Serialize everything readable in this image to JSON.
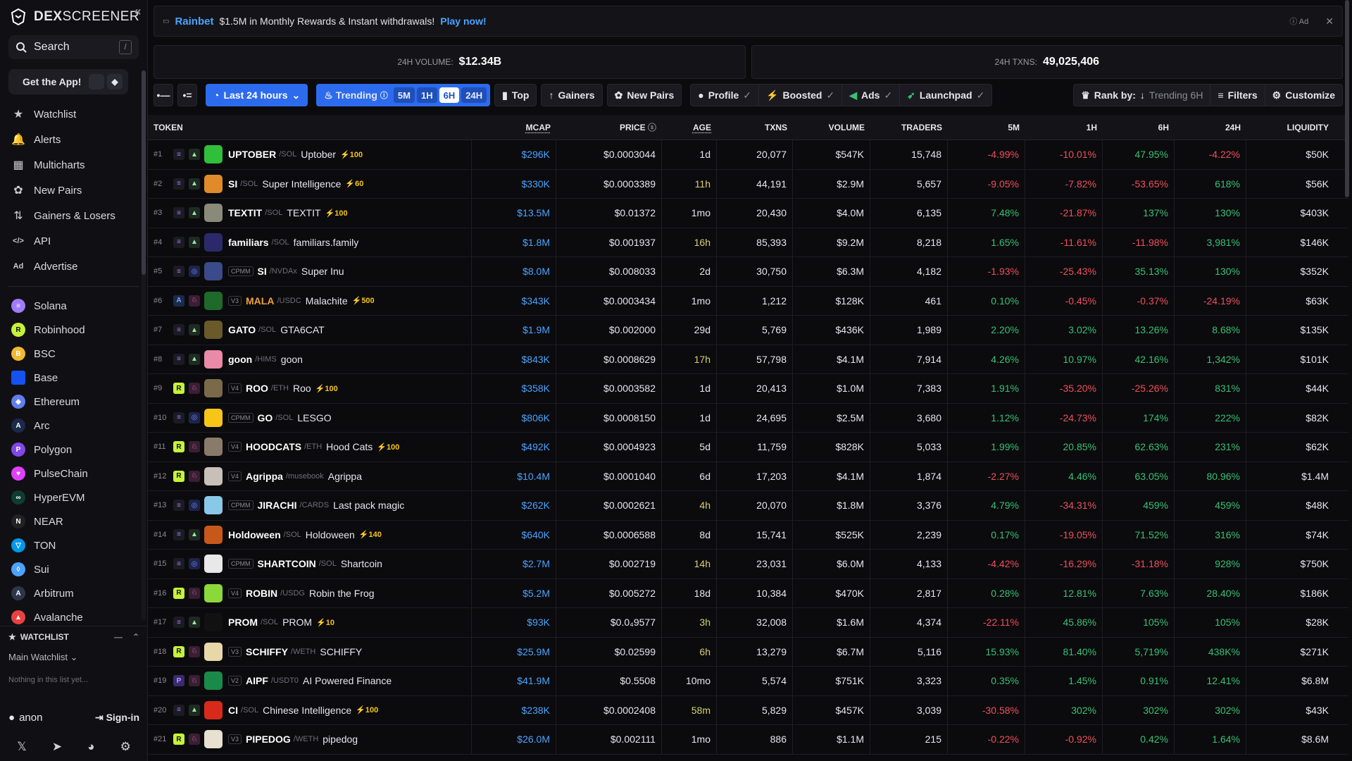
{
  "brand": {
    "name_bold": "DEX",
    "name_light": "SCREENER"
  },
  "search": {
    "label": "Search",
    "shortcut": "/"
  },
  "get_app": {
    "label": "Get the App!"
  },
  "nav": [
    {
      "label": "Watchlist",
      "icon": "star-icon"
    },
    {
      "label": "Alerts",
      "icon": "bell-icon"
    },
    {
      "label": "Multicharts",
      "icon": "grid-icon"
    },
    {
      "label": "New Pairs",
      "icon": "sprout-icon"
    },
    {
      "label": "Gainers & Losers",
      "icon": "arrows-icon"
    },
    {
      "label": "API",
      "icon": "code-icon"
    },
    {
      "label": "Advertise",
      "icon": "ad-icon"
    }
  ],
  "chains": [
    {
      "label": "Solana",
      "color": "#9f7bff",
      "glyph": "≡"
    },
    {
      "label": "Robinhood",
      "color": "#c5f23a",
      "glyph": "R"
    },
    {
      "label": "BSC",
      "color": "#f3ba2f",
      "glyph": "B"
    },
    {
      "label": "Base",
      "color": "#1652f0",
      "glyph": ""
    },
    {
      "label": "Ethereum",
      "color": "#627eea",
      "glyph": "◆"
    },
    {
      "label": "Arc",
      "color": "#1b2a4a",
      "glyph": "A"
    },
    {
      "label": "Polygon",
      "color": "#8247e5",
      "glyph": "P"
    },
    {
      "label": "PulseChain",
      "color": "#e040fb",
      "glyph": "♥"
    },
    {
      "label": "HyperEVM",
      "color": "#0f3b33",
      "glyph": "∞"
    },
    {
      "label": "NEAR",
      "color": "#222",
      "glyph": "N"
    },
    {
      "label": "TON",
      "color": "#0098ea",
      "glyph": "▽"
    },
    {
      "label": "Sui",
      "color": "#4da2ff",
      "glyph": "◊"
    },
    {
      "label": "Arbitrum",
      "color": "#2d374b",
      "glyph": "A"
    },
    {
      "label": "Avalanche",
      "color": "#e84142",
      "glyph": "▲"
    }
  ],
  "watchlist": {
    "title": "WATCHLIST",
    "main": "Main Watchlist",
    "empty": "Nothing in this list yet..."
  },
  "account": {
    "user": "anon",
    "sign_in": "Sign-in"
  },
  "ad": {
    "brand": "Rainbet",
    "text": "$1.5M in Monthly Rewards & Instant withdrawals!",
    "cta": "Play now!",
    "label": "Ad"
  },
  "stats": {
    "volume_label": "24H VOLUME:",
    "volume": "$12.34B",
    "txns_label": "24H TXNS:",
    "txns": "49,025,406"
  },
  "toolbar": {
    "range": "Last 24 hours",
    "trending": "Trending",
    "timeframes": [
      "5M",
      "1H",
      "6H",
      "24H"
    ],
    "active_timeframe": "6H",
    "top": "Top",
    "gainers": "Gainers",
    "new_pairs": "New Pairs",
    "profile": "Profile",
    "boosted": "Boosted",
    "ads": "Ads",
    "launchpad": "Launchpad",
    "rank_by": "Rank by:",
    "rank_value": "Trending 6H",
    "filters": "Filters",
    "customize": "Customize"
  },
  "columns": {
    "token": "TOKEN",
    "mcap": "MCAP",
    "price": "PRICE",
    "age": "AGE",
    "txns": "TXNS",
    "volume": "VOLUME",
    "traders": "TRADERS",
    "m5": "5M",
    "h1": "1H",
    "h6": "6H",
    "h24": "24H",
    "liquidity": "LIQUIDITY"
  },
  "rows": [
    {
      "rank": "#1",
      "chain": "sol",
      "dex": "pump",
      "ver": "",
      "sym": "UPTOBER",
      "quote": "SOL",
      "name": "Uptober",
      "boost": "100",
      "av": "#2fbf3a",
      "mcap": "$296K",
      "price": "$0.0003044",
      "age": "1d",
      "txns": "20,077",
      "volume": "$547K",
      "traders": "15,748",
      "m5": "-4.99%",
      "h1": "-10.01%",
      "h6": "47.95%",
      "h24": "-4.22%",
      "liq": "$50K"
    },
    {
      "rank": "#2",
      "chain": "sol",
      "dex": "pump",
      "ver": "",
      "sym": "SI",
      "quote": "SOL",
      "name": "Super Intelligence",
      "boost": "60",
      "av": "#e08a2a",
      "mcap": "$330K",
      "price": "$0.0003389",
      "age": "11h",
      "txns": "44,191",
      "volume": "$2.9M",
      "traders": "5,657",
      "m5": "-9.05%",
      "h1": "-7.82%",
      "h6": "-53.65%",
      "h24": "618%",
      "liq": "$56K"
    },
    {
      "rank": "#3",
      "chain": "sol",
      "dex": "pump",
      "ver": "",
      "sym": "TEXTIT",
      "quote": "SOL",
      "name": "TEXTIT",
      "boost": "100",
      "av": "#8a8a7a",
      "mcap": "$13.5M",
      "price": "$0.01372",
      "age": "1mo",
      "txns": "20,430",
      "volume": "$4.0M",
      "traders": "6,135",
      "m5": "7.48%",
      "h1": "-21.87%",
      "h6": "137%",
      "h24": "130%",
      "liq": "$403K"
    },
    {
      "rank": "#4",
      "chain": "sol",
      "dex": "pump",
      "ver": "",
      "sym": "familiars",
      "quote": "SOL",
      "name": "familiars.family",
      "boost": "",
      "av": "#2a2a6a",
      "mcap": "$1.8M",
      "price": "$0.001937",
      "age": "16h",
      "txns": "85,393",
      "volume": "$9.2M",
      "traders": "8,218",
      "m5": "1.65%",
      "h1": "-11.61%",
      "h6": "-11.98%",
      "h24": "3,981%",
      "liq": "$146K"
    },
    {
      "rank": "#5",
      "chain": "sol",
      "dex": "c",
      "ver": "CPMM",
      "sym": "SI",
      "quote": "NVDAx",
      "name": "Super Inu",
      "boost": "",
      "av": "#3a4a8a",
      "mcap": "$8.0M",
      "price": "$0.008033",
      "age": "2d",
      "txns": "30,750",
      "volume": "$6.3M",
      "traders": "4,182",
      "m5": "-1.93%",
      "h1": "-25.43%",
      "h6": "35.13%",
      "h24": "130%",
      "liq": "$352K"
    },
    {
      "rank": "#6",
      "chain": "arc",
      "dex": "uni",
      "ver": "V3",
      "sym": "MALA",
      "quote": "USDC",
      "name": "Malachite",
      "boost": "500",
      "av": "#1e6a2a",
      "mcap": "$343K",
      "price": "$0.0003434",
      "age": "1mo",
      "txns": "1,212",
      "volume": "$128K",
      "traders": "461",
      "m5": "0.10%",
      "h1": "-0.45%",
      "h6": "-0.37%",
      "h24": "-24.19%",
      "liq": "$63K",
      "orange": true
    },
    {
      "rank": "#7",
      "chain": "sol",
      "dex": "pump",
      "ver": "",
      "sym": "GATO",
      "quote": "SOL",
      "name": "GTA6CAT",
      "boost": "",
      "av": "#6a5a2a",
      "mcap": "$1.9M",
      "price": "$0.002000",
      "age": "29d",
      "txns": "5,769",
      "volume": "$436K",
      "traders": "1,989",
      "m5": "2.20%",
      "h1": "3.02%",
      "h6": "13.26%",
      "h24": "8.68%",
      "liq": "$135K"
    },
    {
      "rank": "#8",
      "chain": "sol",
      "dex": "pump",
      "ver": "",
      "sym": "goon",
      "quote": "HIMS",
      "name": "goon",
      "boost": "",
      "av": "#e88aa8",
      "mcap": "$843K",
      "price": "$0.0008629",
      "age": "17h",
      "txns": "57,798",
      "volume": "$4.1M",
      "traders": "7,914",
      "m5": "4.26%",
      "h1": "10.97%",
      "h6": "42.16%",
      "h24": "1,342%",
      "liq": "$101K"
    },
    {
      "rank": "#9",
      "chain": "rob",
      "dex": "uni",
      "ver": "V4",
      "sym": "ROO",
      "quote": "ETH",
      "name": "Roo",
      "boost": "100",
      "av": "#7a6a4a",
      "mcap": "$358K",
      "price": "$0.0003582",
      "age": "1d",
      "txns": "20,413",
      "volume": "$1.0M",
      "traders": "7,383",
      "m5": "1.91%",
      "h1": "-35.20%",
      "h6": "-25.26%",
      "h24": "831%",
      "liq": "$44K"
    },
    {
      "rank": "#10",
      "chain": "sol",
      "dex": "c",
      "ver": "CPMM",
      "sym": "GO",
      "quote": "SOL",
      "name": "LESGO",
      "boost": "",
      "av": "#f5c518",
      "mcap": "$806K",
      "price": "$0.0008150",
      "age": "1d",
      "txns": "24,695",
      "volume": "$2.5M",
      "traders": "3,680",
      "m5": "1.12%",
      "h1": "-24.73%",
      "h6": "174%",
      "h24": "222%",
      "liq": "$82K"
    },
    {
      "rank": "#11",
      "chain": "rob",
      "dex": "uni",
      "ver": "V4",
      "sym": "HOODCATS",
      "quote": "ETH",
      "name": "Hood Cats",
      "boost": "100",
      "av": "#8a7a6a",
      "mcap": "$492K",
      "price": "$0.0004923",
      "age": "5d",
      "txns": "11,759",
      "volume": "$828K",
      "traders": "5,033",
      "m5": "1.99%",
      "h1": "20.85%",
      "h6": "62.63%",
      "h24": "231%",
      "liq": "$62K"
    },
    {
      "rank": "#12",
      "chain": "rob",
      "dex": "uni",
      "ver": "V4",
      "sym": "Agrippa",
      "quote": "musebook",
      "name": "Agrippa",
      "boost": "",
      "av": "#c8c0b8",
      "mcap": "$10.4M",
      "price": "$0.0001040",
      "age": "6d",
      "txns": "17,203",
      "volume": "$4.1M",
      "traders": "1,874",
      "m5": "-2.27%",
      "h1": "4.46%",
      "h6": "63.05%",
      "h24": "80.96%",
      "liq": "$1.4M"
    },
    {
      "rank": "#13",
      "chain": "sol",
      "dex": "c",
      "ver": "CPMM",
      "sym": "JIRACHI",
      "quote": "CARDS",
      "name": "Last pack magic",
      "boost": "",
      "av": "#8ac8e8",
      "mcap": "$262K",
      "price": "$0.0002621",
      "age": "4h",
      "txns": "20,070",
      "volume": "$1.8M",
      "traders": "3,376",
      "m5": "4.79%",
      "h1": "-34.31%",
      "h6": "459%",
      "h24": "459%",
      "liq": "$48K"
    },
    {
      "rank": "#14",
      "chain": "sol",
      "dex": "pump",
      "ver": "",
      "sym": "Holdoween",
      "quote": "SOL",
      "name": "Holdoween",
      "boost": "140",
      "av": "#c8581a",
      "mcap": "$640K",
      "price": "$0.0006588",
      "age": "8d",
      "txns": "15,741",
      "volume": "$525K",
      "traders": "2,239",
      "m5": "0.17%",
      "h1": "-19.05%",
      "h6": "71.52%",
      "h24": "316%",
      "liq": "$74K"
    },
    {
      "rank": "#15",
      "chain": "sol",
      "dex": "c",
      "ver": "CPMM",
      "sym": "SHARTCOIN",
      "quote": "SOL",
      "name": "Shartcoin",
      "boost": "",
      "av": "#e8e8e8",
      "mcap": "$2.7M",
      "price": "$0.002719",
      "age": "14h",
      "txns": "23,031",
      "volume": "$6.0M",
      "traders": "4,133",
      "m5": "-4.42%",
      "h1": "-16.29%",
      "h6": "-31.18%",
      "h24": "928%",
      "liq": "$750K"
    },
    {
      "rank": "#16",
      "chain": "rob",
      "dex": "uni",
      "ver": "V4",
      "sym": "ROBIN",
      "quote": "USDG",
      "name": "Robin the Frog",
      "boost": "",
      "av": "#8ad83a",
      "mcap": "$5.2M",
      "price": "$0.005272",
      "age": "18d",
      "txns": "10,384",
      "volume": "$470K",
      "traders": "2,817",
      "m5": "0.28%",
      "h1": "12.81%",
      "h6": "7.63%",
      "h24": "28.40%",
      "liq": "$186K"
    },
    {
      "rank": "#17",
      "chain": "sol",
      "dex": "pump",
      "ver": "",
      "sym": "PROM",
      "quote": "SOL",
      "name": "PROM",
      "boost": "10",
      "av": "#111111",
      "mcap": "$93K",
      "price": "$0.0₄9577",
      "age": "3h",
      "txns": "32,008",
      "volume": "$1.6M",
      "traders": "4,374",
      "m5": "-22.11%",
      "h1": "45.86%",
      "h6": "105%",
      "h24": "105%",
      "liq": "$28K"
    },
    {
      "rank": "#18",
      "chain": "rob",
      "dex": "uni",
      "ver": "V3",
      "sym": "SCHIFFY",
      "quote": "WETH",
      "name": "SCHIFFY",
      "boost": "",
      "av": "#e8d8a8",
      "mcap": "$25.9M",
      "price": "$0.02599",
      "age": "6h",
      "txns": "13,279",
      "volume": "$6.7M",
      "traders": "5,116",
      "m5": "15.93%",
      "h1": "81.40%",
      "h6": "5,719%",
      "h24": "438K%",
      "liq": "$271K"
    },
    {
      "rank": "#19",
      "chain": "poly",
      "dex": "uni",
      "ver": "V2",
      "sym": "AIPF",
      "quote": "USDT0",
      "name": "AI Powered Finance",
      "boost": "",
      "av": "#1a8a4a",
      "mcap": "$41.9M",
      "price": "$0.5508",
      "age": "10mo",
      "txns": "5,574",
      "volume": "$751K",
      "traders": "3,323",
      "m5": "0.35%",
      "h1": "1.45%",
      "h6": "0.91%",
      "h24": "12.41%",
      "liq": "$6.8M"
    },
    {
      "rank": "#20",
      "chain": "sol",
      "dex": "pump",
      "ver": "",
      "sym": "CI",
      "quote": "SOL",
      "name": "Chinese Intelligence",
      "boost": "100",
      "av": "#d82a1a",
      "mcap": "$238K",
      "price": "$0.0002408",
      "age": "58m",
      "txns": "5,829",
      "volume": "$457K",
      "traders": "3,039",
      "m5": "-30.58%",
      "h1": "302%",
      "h6": "302%",
      "h24": "302%",
      "liq": "$43K"
    },
    {
      "rank": "#21",
      "chain": "rob",
      "dex": "uni",
      "ver": "V3",
      "sym": "PIPEDOG",
      "quote": "WETH",
      "name": "pipedog",
      "boost": "",
      "av": "#e8e0d0",
      "mcap": "$26.0M",
      "price": "$0.002111",
      "age": "1mo",
      "txns": "886",
      "volume": "$1.1M",
      "traders": "215",
      "m5": "-0.22%",
      "h1": "-0.92%",
      "h6": "0.42%",
      "h24": "1.64%",
      "liq": "$8.6M"
    }
  ]
}
